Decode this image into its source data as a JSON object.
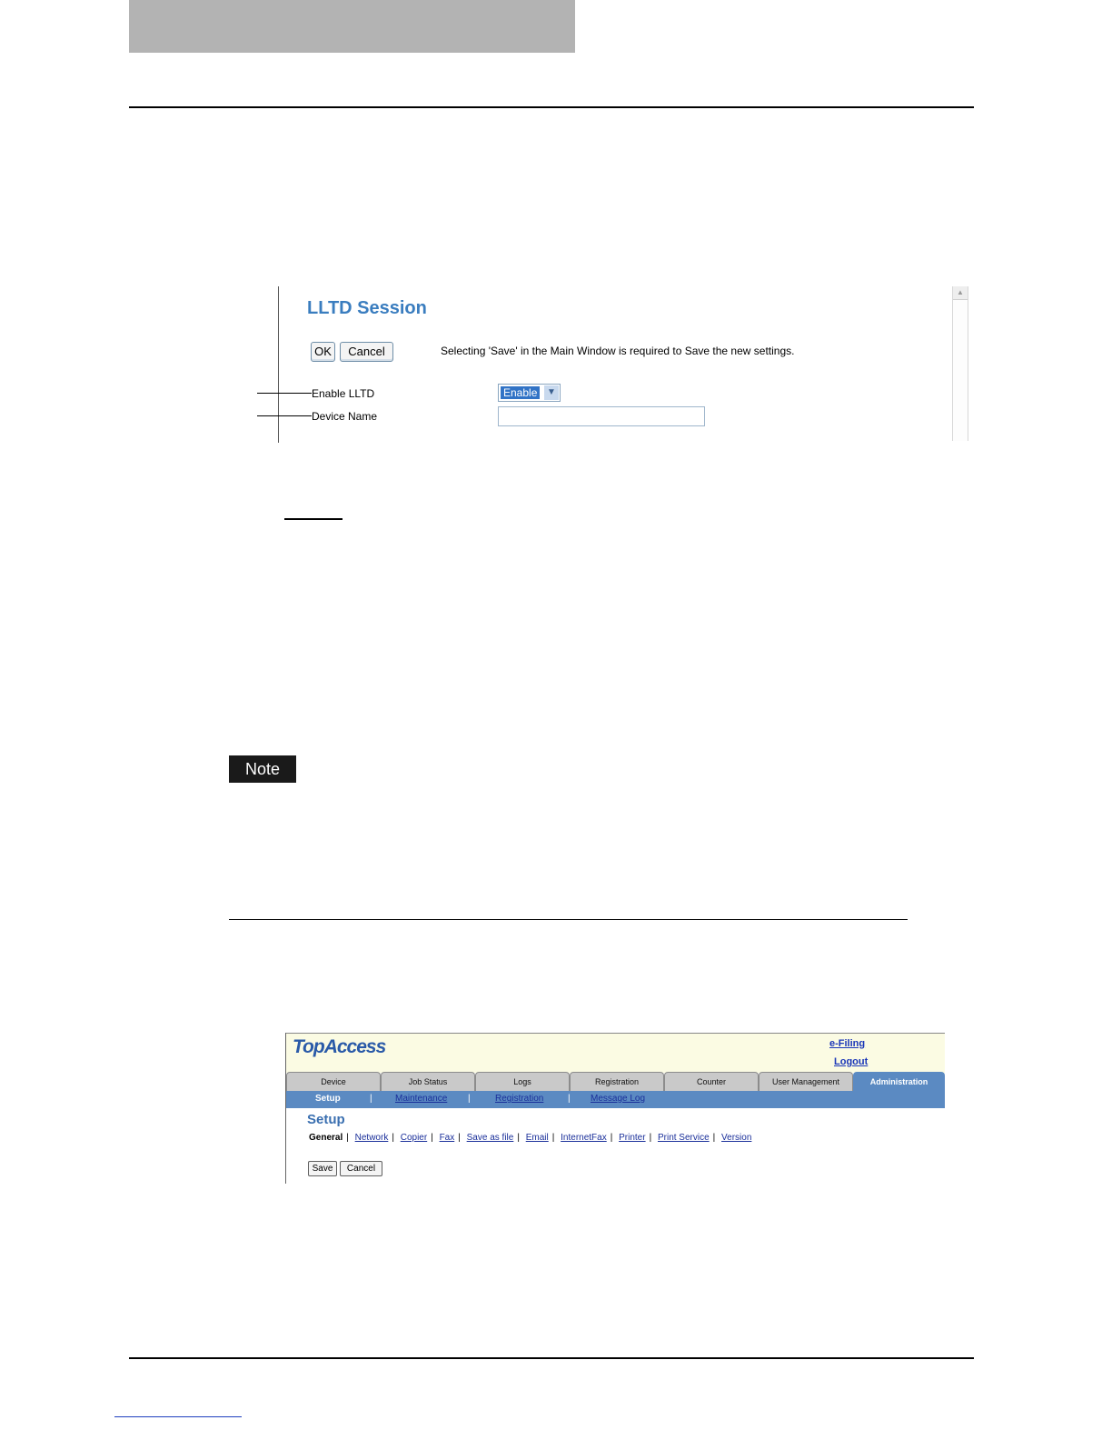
{
  "lltd": {
    "title": "LLTD Session",
    "ok_label": "OK",
    "cancel_label": "Cancel",
    "message": "Selecting 'Save' in the Main Window is required to Save the new settings.",
    "enable_label": "Enable LLTD",
    "enable_value": "Enable",
    "device_name_label": "Device Name",
    "device_name_value": ""
  },
  "note": {
    "label": "Note"
  },
  "topaccess": {
    "logo": "TopAccess",
    "efiling_link": "e-Filing",
    "logout_link": "Logout",
    "tabs": [
      {
        "label": "Device"
      },
      {
        "label": "Job Status"
      },
      {
        "label": "Logs"
      },
      {
        "label": "Registration"
      },
      {
        "label": "Counter"
      },
      {
        "label": "User Management"
      },
      {
        "label": "Administration",
        "active": true
      }
    ],
    "subnav": [
      {
        "label": "Setup",
        "current": true
      },
      {
        "label": "Maintenance"
      },
      {
        "label": "Registration"
      },
      {
        "label": "Message Log"
      }
    ],
    "page_title": "Setup",
    "setup_links": [
      {
        "label": "General",
        "current": true
      },
      {
        "label": "Network"
      },
      {
        "label": "Copier"
      },
      {
        "label": "Fax"
      },
      {
        "label": "Save as file"
      },
      {
        "label": "Email"
      },
      {
        "label": "InternetFax"
      },
      {
        "label": "Printer"
      },
      {
        "label": "Print Service"
      },
      {
        "label": "Version"
      }
    ],
    "save_label": "Save",
    "cancel_label": "Cancel"
  },
  "colors": {
    "accent_blue": "#3a7dbf",
    "nav_blue": "#5b8ac2",
    "header_gray": "#b3b3b3"
  }
}
